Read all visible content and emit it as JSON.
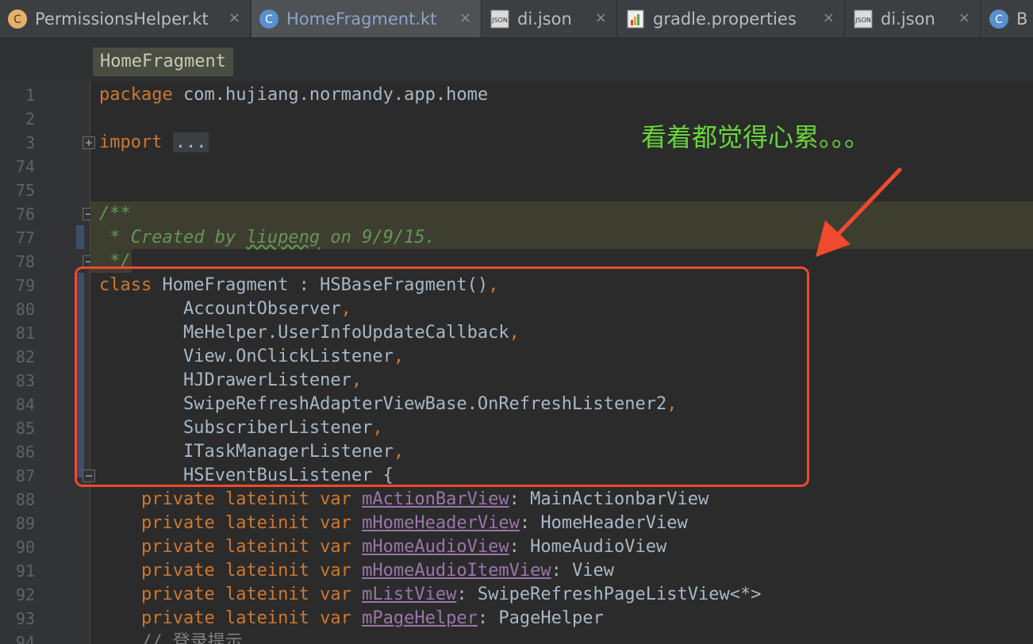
{
  "tabs": [
    {
      "label": "PermissionsHelper.kt",
      "icon": "kotlin-class-icon",
      "active": false,
      "close": "×"
    },
    {
      "label": "HomeFragment.kt",
      "icon": "kotlin-class-icon",
      "active": true,
      "close": "×"
    },
    {
      "label": "di.json",
      "icon": "json-file-icon",
      "active": false,
      "close": "×"
    },
    {
      "label": "gradle.properties",
      "icon": "properties-file-icon",
      "active": false,
      "close": "×"
    },
    {
      "label": "di.json",
      "icon": "json-file-icon",
      "active": false,
      "close": "×"
    },
    {
      "label": "B",
      "icon": "kotlin-class-icon",
      "active": false,
      "close": ""
    }
  ],
  "breadcrumb": "HomeFragment",
  "line_numbers": [
    "1",
    "2",
    "3",
    "74",
    "75",
    "76",
    "77",
    "78",
    "79",
    "80",
    "81",
    "82",
    "83",
    "84",
    "85",
    "86",
    "87",
    "88",
    "89",
    "90",
    "91",
    "92",
    "93",
    "94"
  ],
  "code": {
    "l1_kw": "package",
    "l1_rest": " com.hujiang.normandy.app.home",
    "l3_kw": "import",
    "l3_fold": "...",
    "l76": "/**",
    "l77_a": " * Created by ",
    "l77_author": "liupeng",
    "l77_b": " on 9/9/15.",
    "l78": " */",
    "l79_kw": "class",
    "l79_rest": " HomeFragment : HSBaseFragment()",
    "comma": ",",
    "l80": "        AccountObserver",
    "l81": "        MeHelper.UserInfoUpdateCallback",
    "l82": "        View.OnClickListener",
    "l83": "        HJDrawerListener",
    "l84": "        SwipeRefreshAdapterViewBase.OnRefreshListener2",
    "l85": "        SubscriberListener",
    "l86": "        ITaskManagerListener",
    "l87": "        HSEventBusListener {",
    "indent": "    ",
    "priv": "private lateinit var",
    "fields": [
      {
        "name": "mActionBarView",
        "type": "MainActionbarView"
      },
      {
        "name": "mHomeHeaderView",
        "type": "HomeHeaderView"
      },
      {
        "name": "mHomeAudioView",
        "type": "HomeAudioView"
      },
      {
        "name": "mHomeAudioItemView",
        "type": "View"
      },
      {
        "name": "mListView",
        "type": "SwipeRefreshPageListView<*>"
      },
      {
        "name": "mPageHelper",
        "type": "PageHelper"
      }
    ],
    "colon": ": ",
    "l94": "    // 登录提示"
  },
  "annotation": {
    "text": "看着都觉得心累。。。",
    "text_color": "#67d43a",
    "box_color": "#f04a2e"
  },
  "colors": {
    "background": "#2b2b2b",
    "keyword": "#cc7832",
    "comment": "#629755",
    "field": "#9876aa",
    "text": "#a9b7c6"
  }
}
